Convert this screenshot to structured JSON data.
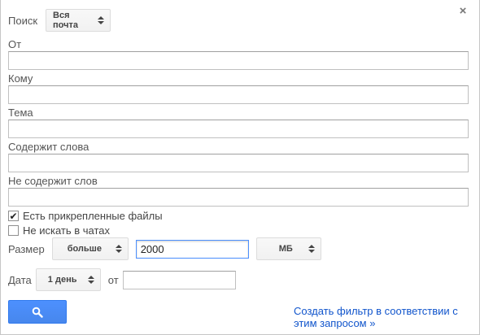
{
  "header": {
    "search_label": "Поиск",
    "scope_select": "Вся почта",
    "close": "×"
  },
  "fields": {
    "from_label": "От",
    "to_label": "Кому",
    "subject_label": "Тема",
    "has_words_label": "Содержит слова",
    "not_words_label": "Не содержит слов"
  },
  "checks": {
    "has_attachment": {
      "label": "Есть прикрепленные файлы",
      "checked": true,
      "mark": "✔"
    },
    "exclude_chats": {
      "label": "Не искать в чатах",
      "checked": false
    }
  },
  "size": {
    "label": "Размер",
    "operator": "больше",
    "value": "2000",
    "unit": "МБ"
  },
  "date": {
    "label": "Дата",
    "range": "1 день",
    "from_label": "от"
  },
  "actions": {
    "create_filter_link": "Создать фильтр в соответствии с этим запросом »"
  },
  "colors": {
    "accent": "#4d90fe",
    "link": "#1155cc"
  },
  "icons": {
    "search_button": "search-icon",
    "close": "close-icon"
  }
}
